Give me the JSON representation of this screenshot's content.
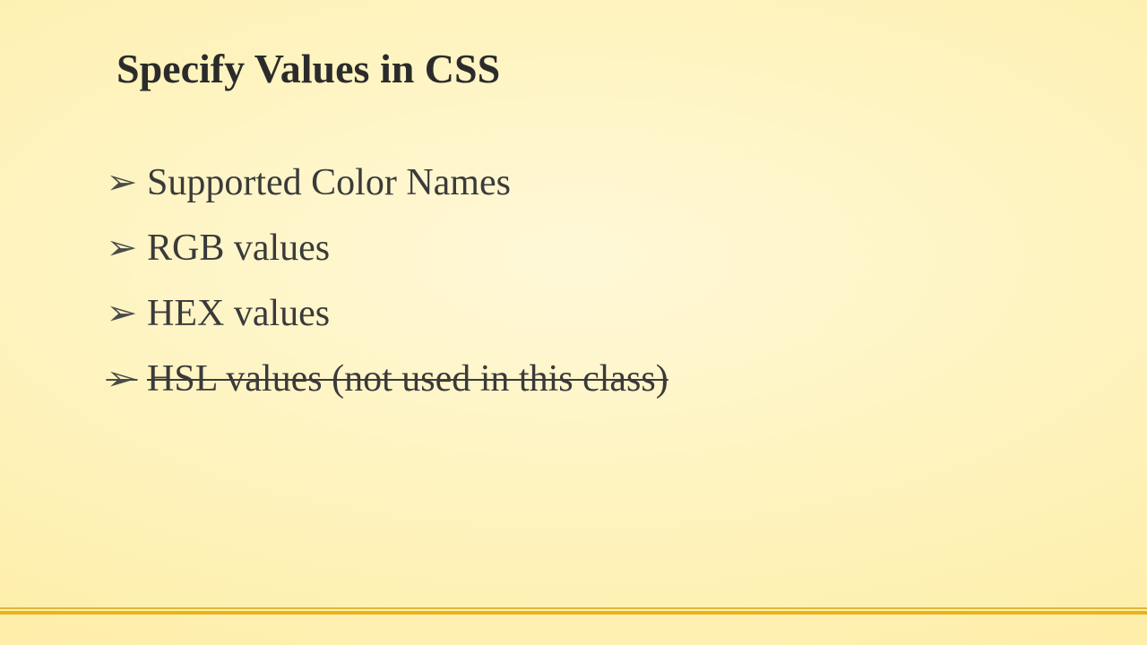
{
  "slide": {
    "title": "Specify Values in CSS",
    "bullets": [
      {
        "text": "Supported Color Names",
        "strike": false
      },
      {
        "text": "RGB values",
        "strike": false
      },
      {
        "text": "HEX values",
        "strike": false
      },
      {
        "text": "HSL values (not used in this class)",
        "strike": true
      }
    ]
  },
  "colors": {
    "text": "#3a3a3a",
    "title": "#2b2b2b",
    "accent": "#e8b41a",
    "bg_inner": "#fff8d8",
    "bg_outer": "#fce58a"
  }
}
